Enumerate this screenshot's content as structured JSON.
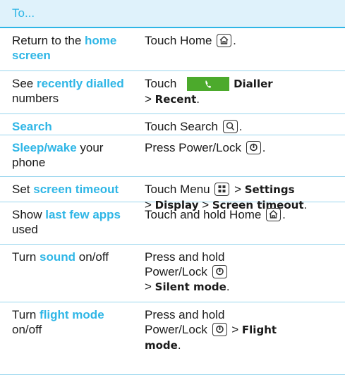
{
  "header": {
    "title": "To..."
  },
  "rows": [
    {
      "c1": [
        {
          "t": "Return to the ",
          "s": "n"
        },
        {
          "t": "home",
          "s": "h"
        }
      ],
      "c1b": [
        {
          "t": "screen",
          "s": "h"
        }
      ],
      "c2": [
        {
          "t": "Touch Home ",
          "s": "n"
        },
        {
          "icon": "home-icon"
        },
        {
          "t": ".",
          "s": "n"
        }
      ]
    },
    {
      "c1": [
        {
          "t": "See ",
          "s": "n"
        },
        {
          "t": "recently dialled",
          "s": "h"
        }
      ],
      "c1b": [
        {
          "t": "numbers",
          "s": "n"
        }
      ],
      "c2": [
        {
          "t": "Touch ",
          "s": "n"
        },
        {
          "icon": "dialler-icon"
        },
        {
          "t": "Dialler",
          "s": "b"
        }
      ],
      "c2b": [
        {
          "t": "> ",
          "s": "n"
        },
        {
          "t": "Recent",
          "s": "b"
        },
        {
          "t": ".",
          "s": "n"
        }
      ]
    },
    {
      "c1": [
        {
          "t": "Search",
          "s": "h"
        }
      ],
      "c2": [
        {
          "t": "Touch Search ",
          "s": "n"
        },
        {
          "icon": "search-icon"
        },
        {
          "t": ".",
          "s": "n"
        }
      ]
    },
    {
      "c1": [
        {
          "t": "Sleep/wake",
          "s": "h"
        },
        {
          "t": " your",
          "s": "n"
        }
      ],
      "c1b": [
        {
          "t": "phone",
          "s": "n"
        }
      ],
      "c2": [
        {
          "t": "Press Power/Lock ",
          "s": "n"
        },
        {
          "icon": "power-icon"
        },
        {
          "t": ".",
          "s": "n"
        }
      ]
    },
    {
      "c1": [
        {
          "t": "Set ",
          "s": "n"
        },
        {
          "t": "screen timeout",
          "s": "h"
        }
      ],
      "c2": [
        {
          "t": "Touch Menu ",
          "s": "n"
        },
        {
          "icon": "menu-icon"
        },
        {
          "t": " > ",
          "s": "n"
        },
        {
          "t": "Settings",
          "s": "b"
        }
      ],
      "c2b": [
        {
          "t": "> ",
          "s": "n"
        },
        {
          "t": "Display",
          "s": "b"
        },
        {
          "t": " > ",
          "s": "n"
        },
        {
          "t": "Screen timeout",
          "s": "b"
        },
        {
          "t": ".",
          "s": "n"
        }
      ]
    },
    {
      "c1": [
        {
          "t": "Show ",
          "s": "n"
        },
        {
          "t": "last few apps",
          "s": "h"
        }
      ],
      "c1b": [
        {
          "t": "used",
          "s": "n"
        }
      ],
      "c2": [
        {
          "t": "Touch and hold Home ",
          "s": "n"
        },
        {
          "icon": "home-icon"
        },
        {
          "t": ".",
          "s": "n"
        }
      ]
    },
    {
      "c1": [
        {
          "t": "Turn ",
          "s": "n"
        },
        {
          "t": "sound",
          "s": "h"
        },
        {
          "t": " on/off",
          "s": "n"
        }
      ],
      "c2": [
        {
          "t": "Press and hold",
          "s": "n"
        }
      ],
      "c2b": [
        {
          "t": "Power/Lock ",
          "s": "n"
        },
        {
          "icon": "power-icon"
        }
      ],
      "c2c": [
        {
          "t": "> ",
          "s": "n"
        },
        {
          "t": "Silent mode",
          "s": "b"
        },
        {
          "t": ".",
          "s": "n"
        }
      ]
    },
    {
      "c1": [
        {
          "t": "Turn ",
          "s": "n"
        },
        {
          "t": "flight mode",
          "s": "h"
        }
      ],
      "c1b": [
        {
          "t": "on/off",
          "s": "n"
        }
      ],
      "c2": [
        {
          "t": "Press and hold",
          "s": "n"
        }
      ],
      "c2b": [
        {
          "t": "Power/Lock ",
          "s": "n"
        },
        {
          "icon": "power-icon"
        },
        {
          "t": " > ",
          "s": "n"
        },
        {
          "t": "Flight",
          "s": "b"
        }
      ],
      "c2c": [
        {
          "t": "mode",
          "s": "b"
        },
        {
          "t": ".",
          "s": "n"
        }
      ]
    }
  ],
  "colors": {
    "accent": "#2fb6e6",
    "header_bg": "#dff2fb",
    "dialler_green": "#4caa2c"
  }
}
